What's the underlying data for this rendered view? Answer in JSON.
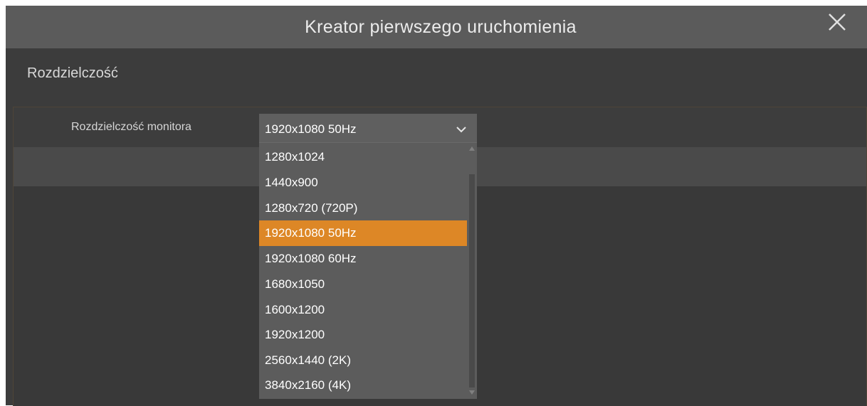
{
  "window": {
    "title": "Kreator pierwszego uruchomienia",
    "close_icon": "close-icon"
  },
  "section": {
    "title": "Rozdzielczość"
  },
  "resolution_field": {
    "label": "Rozdzielczość monitora",
    "value": "1920x1080 50Hz",
    "chevron_icon": "chevron-down-icon"
  },
  "dropdown": {
    "options": [
      "1280x1024",
      "1440x900",
      "1280x720 (720P)",
      "1920x1080 50Hz",
      "1920x1080 60Hz",
      "1680x1050",
      "1600x1200",
      "1920x1200",
      "2560x1440 (2K)",
      "3840x2160 (4K)"
    ],
    "selected_index": 3
  },
  "colors": {
    "titlebar": "#5b5b5b",
    "background": "#3c3c3c",
    "accent": "#dd8726",
    "dropdown": "#5c5c5c"
  }
}
